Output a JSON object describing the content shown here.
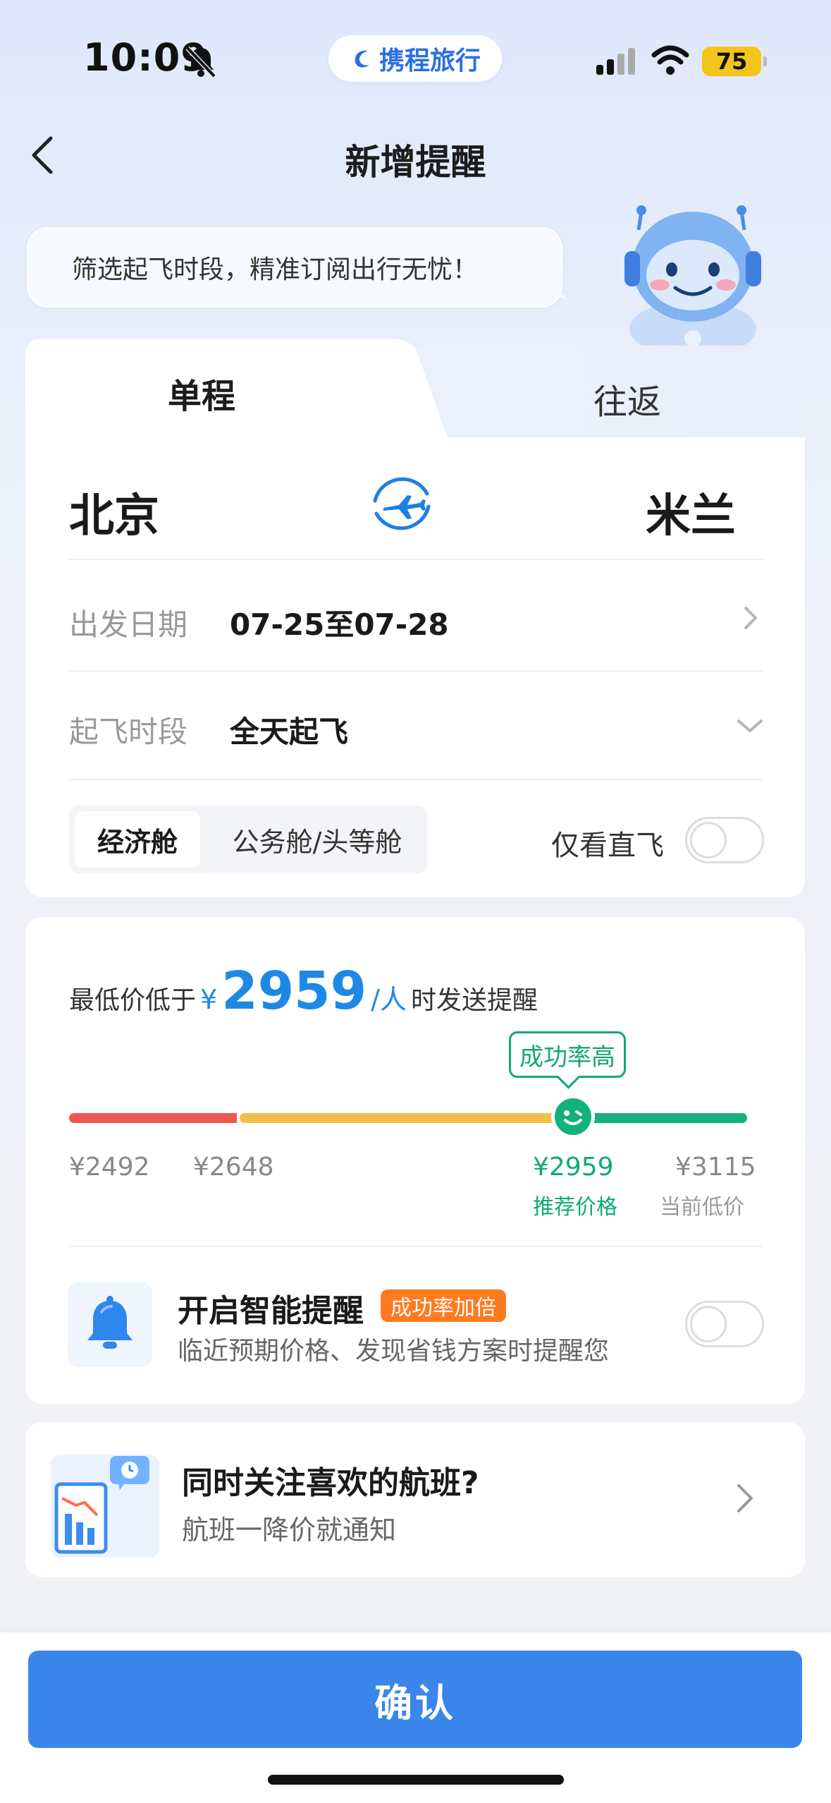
{
  "status_bar": {
    "time": "10:09",
    "battery": "75"
  },
  "brand": {
    "name": "携程旅行"
  },
  "header": {
    "title": "新增提醒"
  },
  "tip": {
    "text": "筛选起飞时段，精准订阅出行无忧！"
  },
  "trip_tabs": {
    "one_way": "单程",
    "round_trip": "往返"
  },
  "route": {
    "from": "北京",
    "to": "米兰"
  },
  "date_row": {
    "label": "出发日期",
    "value": "07-25至07-28"
  },
  "time_row": {
    "label": "起飞时段",
    "value": "全天起飞"
  },
  "cabin": {
    "economy": "经济舱",
    "business": "公务舱/头等舱",
    "direct_label": "仅看直飞",
    "direct_only": false
  },
  "price_alert": {
    "prefix": "最低价低于",
    "currency": "¥",
    "price": "2959",
    "unit": "/人",
    "suffix": "时发送提醒",
    "success_tag": "成功率高",
    "ticks": [
      {
        "price": "¥2492",
        "sub": ""
      },
      {
        "price": "¥2648",
        "sub": ""
      },
      {
        "price": "¥2959",
        "sub": "推荐价格"
      },
      {
        "price": "¥3115",
        "sub": "当前低价"
      }
    ]
  },
  "smart_alert": {
    "title": "开启智能提醒",
    "badge": "成功率加倍",
    "desc": "临近预期价格、发现省钱方案时提醒您",
    "enabled": false
  },
  "favorite": {
    "title": "同时关注喜欢的航班?",
    "desc": "航班一降价就通知"
  },
  "footer": {
    "confirm": "确认"
  },
  "colors": {
    "accent": "#3a86ea",
    "price_blue": "#1e88e5",
    "green": "#12b27a",
    "red": "#f25452",
    "yellow": "#f2c04a",
    "orange": "#ff7a1f"
  }
}
